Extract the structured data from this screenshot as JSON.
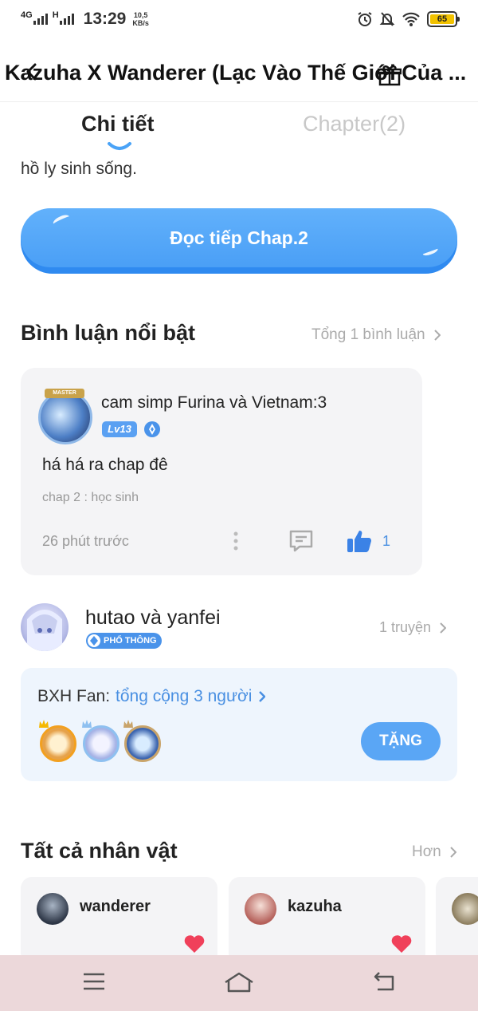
{
  "status_bar": {
    "network_1": "4G",
    "network_2": "H",
    "time": "13:29",
    "speed_value": "10,5",
    "speed_unit": "KB/s",
    "battery": "65"
  },
  "header": {
    "title": "Kazuha X Wanderer (Lạc Vào Thế Giới Của ..."
  },
  "tabs": [
    {
      "label": "Chi tiết",
      "active": true
    },
    {
      "label": "Chapter(2)",
      "active": false
    }
  ],
  "description_tail": "hồ ly sinh sống.",
  "read_button": {
    "label": "Đọc tiếp Chap.2"
  },
  "comments_section": {
    "title": "Bình luận nổi bật",
    "total": "Tổng 1 bình luận",
    "comment": {
      "avatar_tag": "MASTER",
      "user": "cam simp Furina và Vietnam:3",
      "level": "Lv13",
      "text": "há há ra chap đê",
      "chapter": "chap 2 : học sinh",
      "time": "26 phút trước",
      "likes": "1"
    }
  },
  "author": {
    "name": "hutao và yanfei",
    "badge": "PHỔ THÔNG",
    "stories": "1 truyện"
  },
  "fan_ranking": {
    "label": "BXH Fan:",
    "total": "tổng cộng 3 người",
    "gift_button": "TẶNG"
  },
  "characters_section": {
    "title": "Tất cả nhân vật",
    "more": "Hơn",
    "items": [
      {
        "name": "wanderer"
      },
      {
        "name": "kazuha"
      }
    ]
  },
  "colors": {
    "accent": "#4a90e2",
    "button": "#5aa6f5",
    "navbar": "#ecd8da",
    "heart": "#f0405a"
  }
}
